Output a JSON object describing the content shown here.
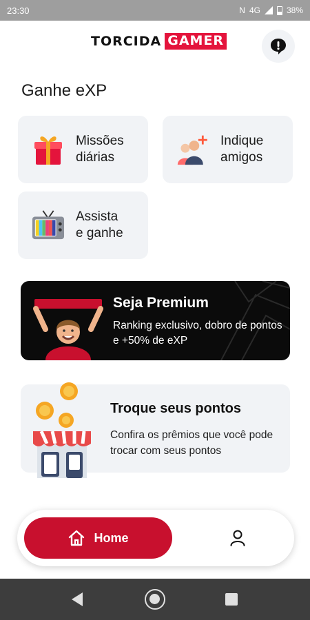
{
  "status_bar": {
    "time": "23:30",
    "network": "4G",
    "battery": "38%"
  },
  "header": {
    "logo_part1": "TORCIDA",
    "logo_part2": "GAMER",
    "help_icon": "alert-bubble-icon"
  },
  "earn": {
    "title": "Ganhe eXP",
    "tiles": [
      {
        "label": "Missões\ndiárias",
        "icon": "gift-icon"
      },
      {
        "label": "Indique\namigos",
        "icon": "people-add-icon"
      },
      {
        "label": "Assista\ne ganhe",
        "icon": "tv-icon"
      }
    ]
  },
  "premium": {
    "title": "Seja Premium",
    "text": "Ranking exclusivo, dobro de pontos e +50% de eXP",
    "icon": "fan-holding-banner-illustration"
  },
  "trade": {
    "title": "Troque seus pontos",
    "text": "Confira os prêmios que você pode trocar com seus pontos",
    "icon": "store-coins-illustration"
  },
  "bottom_nav": {
    "home_label": "Home",
    "home_icon": "house-icon",
    "profile_icon": "person-icon"
  },
  "colors": {
    "brand_red": "#c8102e",
    "logo_red": "#e4143c",
    "tile_bg": "#f1f3f6"
  }
}
